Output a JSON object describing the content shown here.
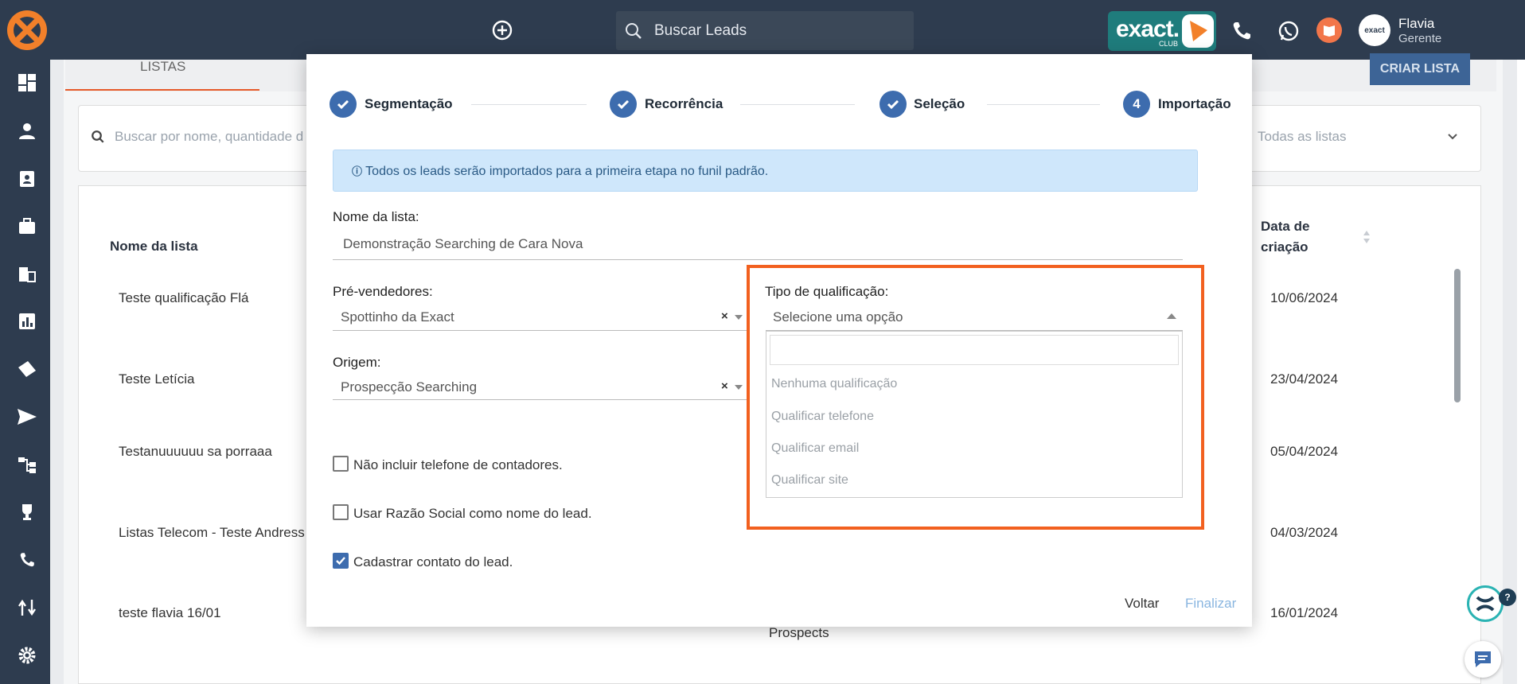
{
  "topbar": {
    "search_placeholder": "Buscar Leads",
    "badge_brand": "exact.",
    "badge_sub": "CLUB",
    "avatar_text": "exact",
    "user_name": "Flavia",
    "user_role": "Gerente"
  },
  "sidebar": {
    "icons": [
      "dashboard-icon",
      "person-icon",
      "contact-card-icon",
      "briefcase-icon",
      "building-icon",
      "chart-icon",
      "tags-icon",
      "send-icon",
      "flow-icon",
      "trophy-icon",
      "phone-icon",
      "route-icon",
      "gear-icon"
    ]
  },
  "page": {
    "tab_label": "LISTAS",
    "create_button": "CRIAR LISTA",
    "filter_placeholder": "Buscar por nome, quantidade d",
    "filter_select": "Todas as listas",
    "col_name": "Nome da lista",
    "col_date_line1": "Data de",
    "col_date_line2": "criação",
    "rows": [
      {
        "name": "Teste qualificação Flá",
        "date": "10/06/2024"
      },
      {
        "name": "Teste Letícia",
        "date": "23/04/2024"
      },
      {
        "name": "Testanuuuuuu sa porraaa",
        "date": "05/04/2024"
      },
      {
        "name": "Listas Telecom - Teste Andress",
        "date": "04/03/2024"
      },
      {
        "name": "teste flavia 16/01",
        "date": "16/01/2024"
      }
    ],
    "prospects": "Prospects"
  },
  "modal": {
    "steps": [
      {
        "label": "Segmentação",
        "state": "done"
      },
      {
        "label": "Recorrência",
        "state": "done"
      },
      {
        "label": "Seleção",
        "state": "done"
      },
      {
        "label": "Importação",
        "state": "current",
        "number": "4"
      }
    ],
    "info": "Todos os leads serão importados para a primeira etapa no funil padrão.",
    "list_name_label": "Nome da lista:",
    "list_name_value": "Demonstração Searching de Cara Nova",
    "presellers_label": "Pré-vendedores:",
    "presellers_value": "Spottinho da Exact",
    "origin_label": "Origem:",
    "origin_value": "Prospecção Searching",
    "qual_label": "Tipo de qualificação:",
    "qual_placeholder": "Selecione uma opção",
    "qual_options": [
      "Nenhuma qualificação",
      "Qualificar telefone",
      "Qualificar email",
      "Qualificar site"
    ],
    "checkboxes": [
      {
        "label": "Não incluir telefone de contadores.",
        "checked": false
      },
      {
        "label": "Usar Razão Social como nome do lead.",
        "checked": false
      },
      {
        "label": "Cadastrar contato do lead.",
        "checked": true
      }
    ],
    "back_button": "Voltar",
    "finish_button": "Finalizar",
    "clear_symbol": "×"
  },
  "colors": {
    "sidebar": "#2e3c4f",
    "step": "#3d6cae",
    "highlight": "#f2601f",
    "brand_teal": "#1f7c7c"
  }
}
